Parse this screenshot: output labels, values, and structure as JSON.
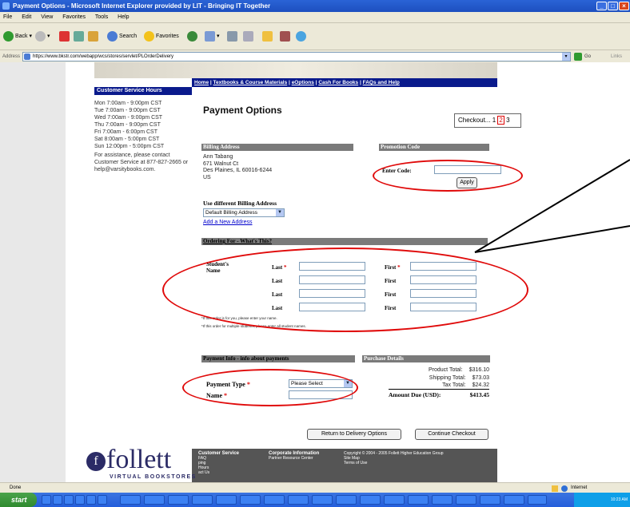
{
  "window": {
    "title": "Payment Options - Microsoft Internet Explorer provided by LIT - Bringing IT Together"
  },
  "menu": [
    "File",
    "Edit",
    "View",
    "Favorites",
    "Tools",
    "Help"
  ],
  "toolbar": {
    "back": "Back",
    "search": "Search",
    "favorites": "Favorites"
  },
  "address": {
    "label": "Address",
    "url": "https://www.bkstr.com/webapp/wcs/stores/servlet/PLOrderDelivery",
    "go": "Go",
    "links": "Links"
  },
  "nav": {
    "home": "Home",
    "textbooks": "Textbooks & Course Materials",
    "eoptions": "eOptions",
    "cash": "Cash For Books",
    "faqs": "FAQs and Help",
    "sep": "|"
  },
  "sidebar": {
    "title": "Customer Service Hours",
    "hours": [
      "Mon 7:00am - 9:00pm CST",
      "Tue  7:00am - 9:00pm CST",
      "Wed 7:00am - 9:00pm CST",
      "Thu  7:00am - 9:00pm CST",
      "Fri   7:00am - 6:00pm CST",
      "Sat  8:00am - 5:00pm CST",
      "Sun 12:00pm - 5:00pm CST"
    ],
    "assist": "For assistance, please contact Customer Service at 877-827-2665 or help@varsitybooks.com."
  },
  "main": {
    "title": "Payment Options",
    "checkout": {
      "label": "Checkout...",
      "step1": "1",
      "step2": "2",
      "step3": "3"
    },
    "billing": {
      "header": "Billing Address",
      "name": "Ann Tabang",
      "street": "671 Walnut Ct",
      "city": "Des Plaines, IL  60016-6244",
      "country": "US",
      "use_different": "Use different Billing Address",
      "select_value": "Default Billing Address",
      "add_link": "Add a New Address"
    },
    "promo": {
      "header": "Promotion Code",
      "label": "Enter Code:",
      "apply": "Apply"
    },
    "ordering": {
      "header": "Ordering For - What's This?",
      "students_label": "Student's Name",
      "last": "Last",
      "first": "First",
      "req": "*",
      "note1": "*If this order is for you, please enter your name.",
      "note2": "*If this order for multiple students, please enter all student names."
    },
    "payment": {
      "header": "Payment Info - info about payments",
      "type_label": "Payment Type",
      "select_value": "Please Select",
      "name_label": "Name",
      "req": "*"
    },
    "purchase": {
      "header": "Purchase Details",
      "rows": [
        {
          "label": "Product Total:",
          "value": "$316.10"
        },
        {
          "label": "Shipping Total:",
          "value": "$73.03"
        },
        {
          "label": "Tax Total:",
          "value": "$24.32"
        }
      ],
      "amount_label": "Amount Due (USD):",
      "amount_value": "$413.45"
    },
    "buttons": {
      "return": "Return to Delivery Options",
      "continue": "Continue Checkout"
    }
  },
  "footer": {
    "col1_title": "Customer Service",
    "col1_items": [
      "FAQ",
      "ping",
      "Hours",
      "act Us"
    ],
    "col2_title": "Corporate Information",
    "col2_items": [
      "Partner Resource Center"
    ],
    "col3_items": [
      "Copyright © 2004 - 2005 Follett Higher Education Group",
      "Site Map",
      "Terms of Use"
    ]
  },
  "logo": {
    "text": "follett",
    "sub": "VIRTUAL BOOKSTORES"
  },
  "status": {
    "left": "Done",
    "zone": "Internet"
  },
  "taskbar": {
    "start": "start",
    "clock": "10:23 AM"
  }
}
